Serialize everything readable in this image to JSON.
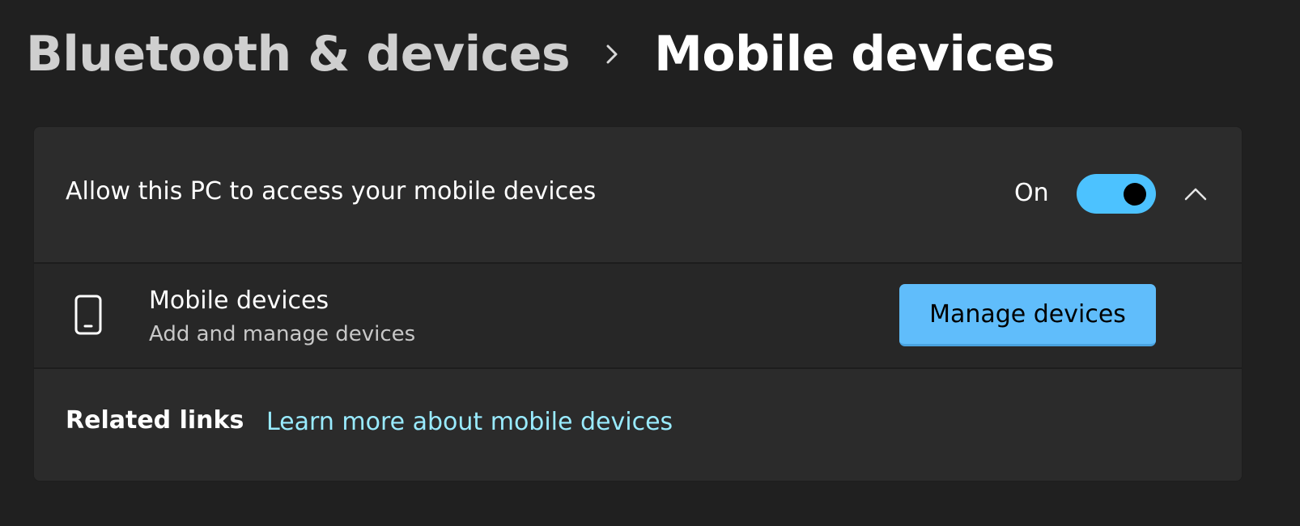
{
  "breadcrumb": {
    "parent": "Bluetooth & devices",
    "separator_icon": "chevron-right-icon",
    "current": "Mobile devices"
  },
  "access_setting": {
    "label": "Allow this PC to access your mobile devices",
    "state_label": "On",
    "toggle_on": true,
    "expand_icon": "chevron-up-icon"
  },
  "mobile_devices": {
    "icon": "phone-icon",
    "title": "Mobile devices",
    "subtitle": "Add and manage devices",
    "button_label": "Manage devices"
  },
  "related_links": {
    "label": "Related links",
    "link_text": "Learn more about mobile devices"
  },
  "colors": {
    "background": "#202020",
    "card": "#2b2b2b",
    "accent": "#4cc2ff",
    "button": "#60bdfb",
    "link": "#99ebff"
  }
}
